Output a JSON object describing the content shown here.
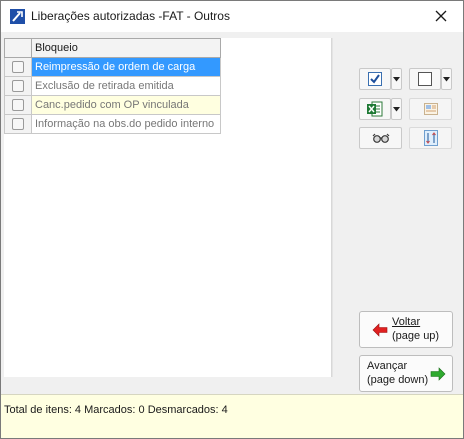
{
  "window": {
    "title": "Liberações autorizadas -FAT - Outros"
  },
  "grid": {
    "column_header": "Bloqueio",
    "rows": [
      {
        "label": "Reimpressão de ordem de carga",
        "checked": false,
        "state": "selected"
      },
      {
        "label": "Exclusão de retirada emitida",
        "checked": false,
        "state": "normal"
      },
      {
        "label": "Canc.pedido com OP vinculada",
        "checked": false,
        "state": "highlight"
      },
      {
        "label": "Informação na obs.do pedido interno",
        "checked": false,
        "state": "normal"
      }
    ]
  },
  "toolbar": {
    "icons": [
      "check-all-icon",
      "uncheck-all-icon",
      "excel-export-icon",
      "report-icon",
      "glasses-icon",
      "filter-icon"
    ]
  },
  "nav": {
    "back_line1": "Voltar",
    "back_line2": "(page up)",
    "next_line1": "Avançar",
    "next_line2": "(page down)"
  },
  "status": {
    "text": "Total de itens: 4 Marcados: 0 Desmarcados: 4"
  },
  "colors": {
    "selection": "#3399ff",
    "highlight_row": "#ffffe0",
    "status_bar": "#ffffe1",
    "arrow_back": "#e02020",
    "arrow_next": "#2faa2f"
  }
}
